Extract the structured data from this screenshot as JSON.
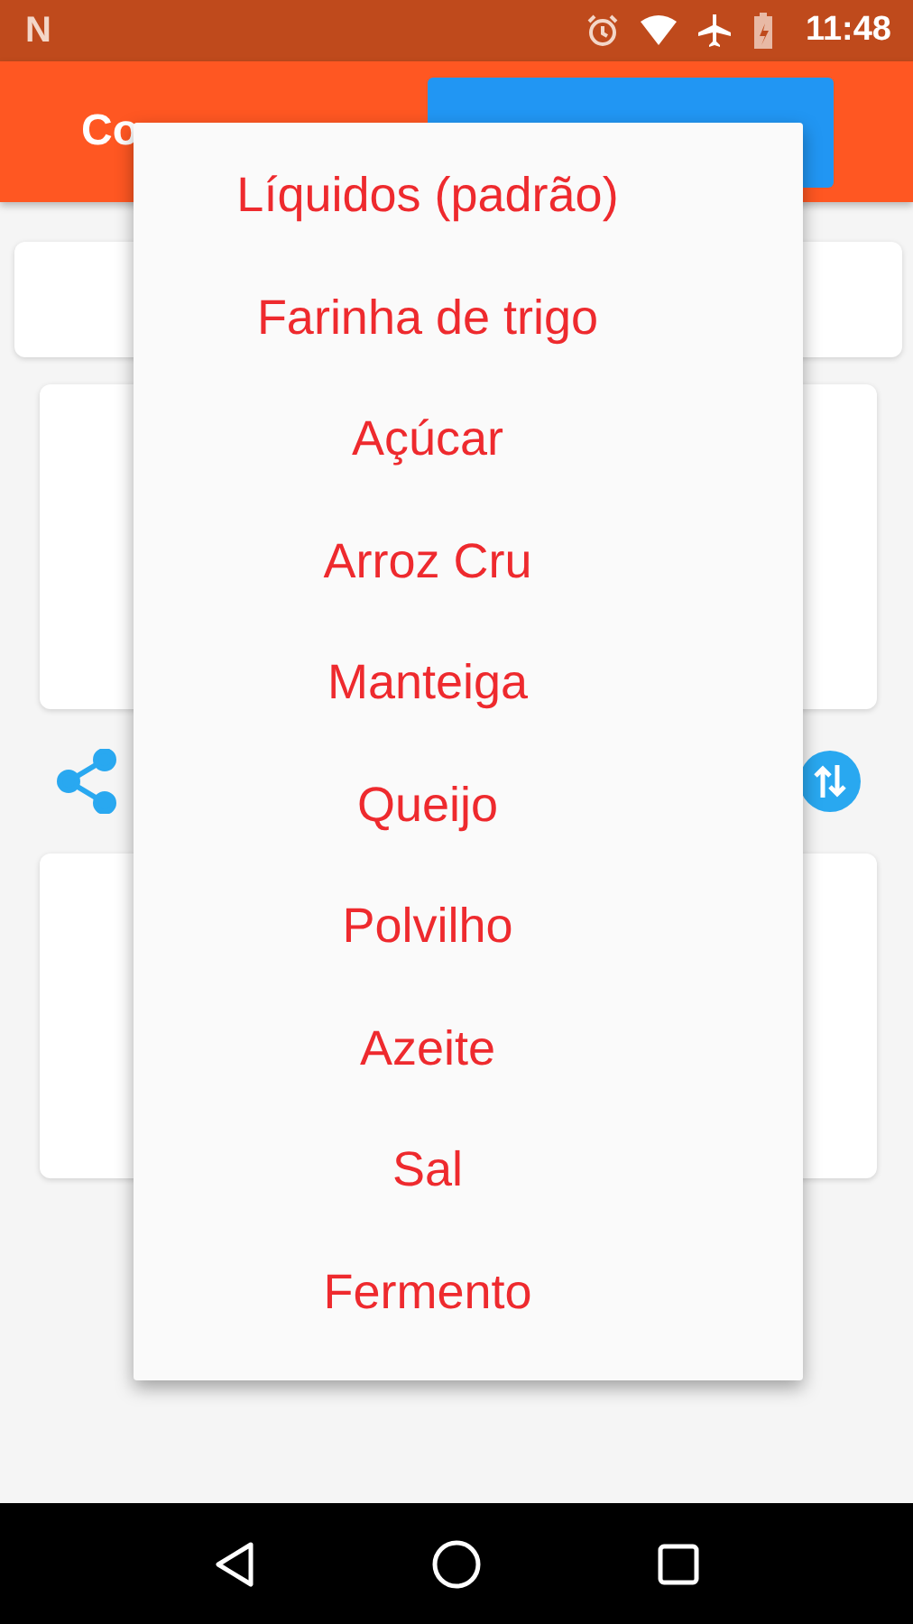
{
  "status_bar": {
    "notification_glyph": "N",
    "time": "11:48"
  },
  "app_bar": {
    "title": "Co"
  },
  "menu": {
    "items": [
      {
        "label": "Líquidos (padrão)"
      },
      {
        "label": "Farinha de trigo"
      },
      {
        "label": "Açúcar"
      },
      {
        "label": "Arroz Cru"
      },
      {
        "label": "Manteiga"
      },
      {
        "label": "Queijo"
      },
      {
        "label": "Polvilho"
      },
      {
        "label": "Azeite"
      },
      {
        "label": "Sal"
      },
      {
        "label": "Fermento"
      }
    ]
  }
}
